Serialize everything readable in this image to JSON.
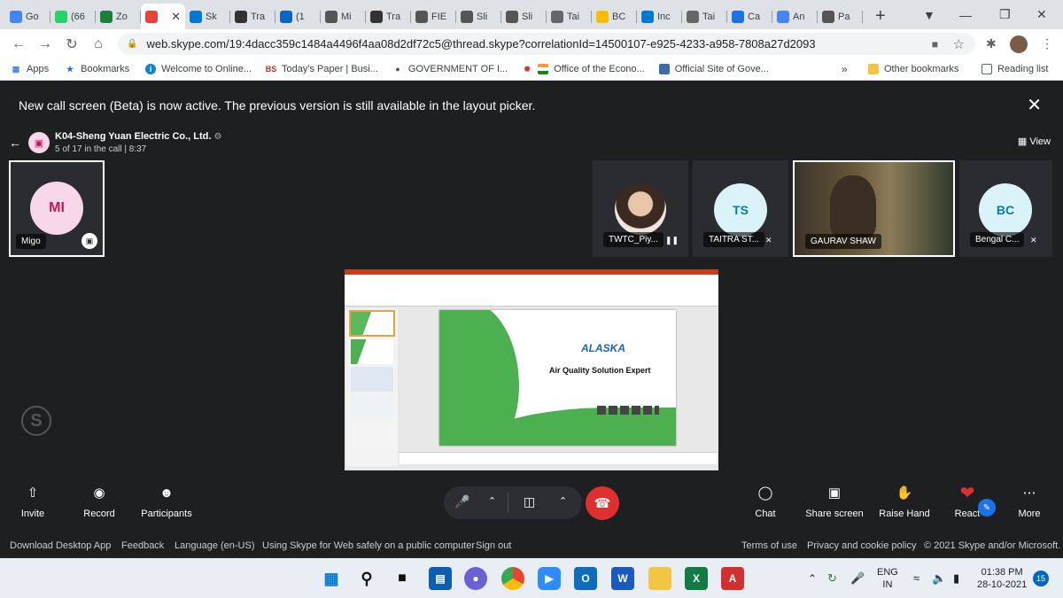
{
  "browser": {
    "tabs": [
      {
        "label": "Go",
        "icon": "google-icon",
        "color": "#4285f4"
      },
      {
        "label": "(66",
        "icon": "whatsapp-icon",
        "color": "#25d366"
      },
      {
        "label": "Zo",
        "icon": "zoho-icon",
        "color": "#188038"
      },
      {
        "label": "",
        "icon": "recording-icon",
        "color": "#ea4335",
        "active": true
      },
      {
        "label": "Sk",
        "icon": "skype-icon",
        "color": "#0078d4"
      },
      {
        "label": "Tra",
        "icon": "trade-icon",
        "color": "#333333"
      },
      {
        "label": "(1",
        "icon": "linkedin-icon",
        "color": "#0a66c2"
      },
      {
        "label": "Mi",
        "icon": "globe-icon",
        "color": "#555555"
      },
      {
        "label": "Tra",
        "icon": "trade-icon",
        "color": "#333333"
      },
      {
        "label": "FIE",
        "icon": "globe-icon",
        "color": "#555555"
      },
      {
        "label": "Sli",
        "icon": "globe-icon",
        "color": "#555555"
      },
      {
        "label": "Sli",
        "icon": "globe-icon",
        "color": "#555555"
      },
      {
        "label": "Tai",
        "icon": "taiwan-icon",
        "color": "#666666"
      },
      {
        "label": "BC",
        "icon": "drive-icon",
        "color": "#fbbc04"
      },
      {
        "label": "Inc",
        "icon": "skype-icon",
        "color": "#0078d4"
      },
      {
        "label": "Tai",
        "icon": "taiwan-icon",
        "color": "#666666"
      },
      {
        "label": "Ca",
        "icon": "calendar-icon",
        "color": "#1a73e8"
      },
      {
        "label": "An",
        "icon": "docs-icon",
        "color": "#4285f4"
      },
      {
        "label": "Pa",
        "icon": "globe-icon",
        "color": "#555555"
      }
    ],
    "url": "web.skype.com/19:4dacc359c1484a4496f4aa08d2df72c5@thread.skype?correlationId=14500107-e925-4233-a958-7808a27d2093",
    "bookmarks": [
      "Apps",
      "Bookmarks",
      "Welcome to Online...",
      "Today's Paper | Busi...",
      "GOVERNMENT OF I...",
      "Office of the Econo...",
      "Official Site of Gove..."
    ],
    "other_bookmarks": "Other bookmarks",
    "reading_list": "Reading list",
    "more_bookmarks": "»"
  },
  "banner": {
    "text": "New call screen (Beta) is now active. The previous version is still available in the layout picker."
  },
  "call": {
    "group_name": "K04-Sheng Yuan Electric Co., Ltd.",
    "status": "5 of 17 in the call | 8:37",
    "view_label": "View",
    "self": {
      "initials": "MI",
      "name": "Migo"
    },
    "participants": [
      {
        "initials": "",
        "name": "TWTC_Piy..."
      },
      {
        "initials": "TS",
        "name": "TAITRA ST..."
      },
      {
        "initials": "",
        "name": "GAURAV SHAW"
      },
      {
        "initials": "BC",
        "name": "Bengal C..."
      }
    ]
  },
  "shared_slide": {
    "brand": "ALASKA",
    "tagline": "Air Quality Solution Expert"
  },
  "controls": {
    "invite": "Invite",
    "record": "Record",
    "participants": "Participants",
    "chat": "Chat",
    "share_screen": "Share screen",
    "raise_hand": "Raise Hand",
    "react": "React",
    "more": "More"
  },
  "footer": {
    "download": "Download Desktop App",
    "feedback": "Feedback",
    "language": "Language (en-US)",
    "safety": "Using Skype for Web safely on a public computer",
    "signout": "Sign out",
    "terms": "Terms of use",
    "privacy": "Privacy and cookie policy",
    "copyright": "© 2021 Skype and/or Microsoft."
  },
  "taskbar": {
    "lang": "ENG",
    "region": "IN",
    "time": "01:38 PM",
    "date": "28-10-2021",
    "notifications": "15"
  },
  "colors": {
    "accent": "#0078d4",
    "hangup": "#e02f2f",
    "heart": "#e02f2f"
  }
}
